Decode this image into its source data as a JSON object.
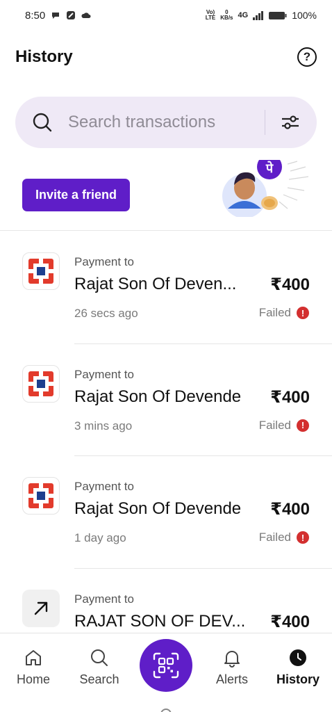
{
  "status_bar": {
    "time": "8:50",
    "network_top": "Vo)",
    "network_bottom": "LTE",
    "speed_top": "0",
    "speed_bottom": "KB/s",
    "signal": "4G",
    "battery": "100%"
  },
  "header": {
    "title": "History",
    "help_icon": "question-circle-icon"
  },
  "search": {
    "placeholder": "Search transactions",
    "filter_icon": "sliders-icon"
  },
  "promo": {
    "button_label": "Invite a friend",
    "badge_text": "पे",
    "colors": {
      "brand": "#5f1ec8"
    }
  },
  "transactions": [
    {
      "type": "Payment to",
      "name": "Rajat Son Of Deven...",
      "amount": "₹400",
      "time": "26 secs ago",
      "status": "Failed",
      "logo": "bank-logo"
    },
    {
      "type": "Payment to",
      "name": "Rajat Son Of Devende",
      "amount": "₹400",
      "time": "3 mins ago",
      "status": "Failed",
      "logo": "bank-logo"
    },
    {
      "type": "Payment to",
      "name": "Rajat Son Of Devende",
      "amount": "₹400",
      "time": "1 day ago",
      "status": "Failed",
      "logo": "bank-logo"
    },
    {
      "type": "Payment to",
      "name": "RAJAT SON OF DEV...",
      "amount": "₹400",
      "time": "",
      "status": "",
      "logo": "arrow-up-right-icon"
    }
  ],
  "status_colors": {
    "failed": "#d32f2f"
  },
  "bottom_nav": {
    "items": [
      {
        "label": "Home",
        "icon": "home-icon"
      },
      {
        "label": "Search",
        "icon": "search-icon"
      },
      {
        "label": "",
        "icon": "qr-scan-icon"
      },
      {
        "label": "Alerts",
        "icon": "bell-icon"
      },
      {
        "label": "History",
        "icon": "clock-icon",
        "active": true
      }
    ]
  }
}
